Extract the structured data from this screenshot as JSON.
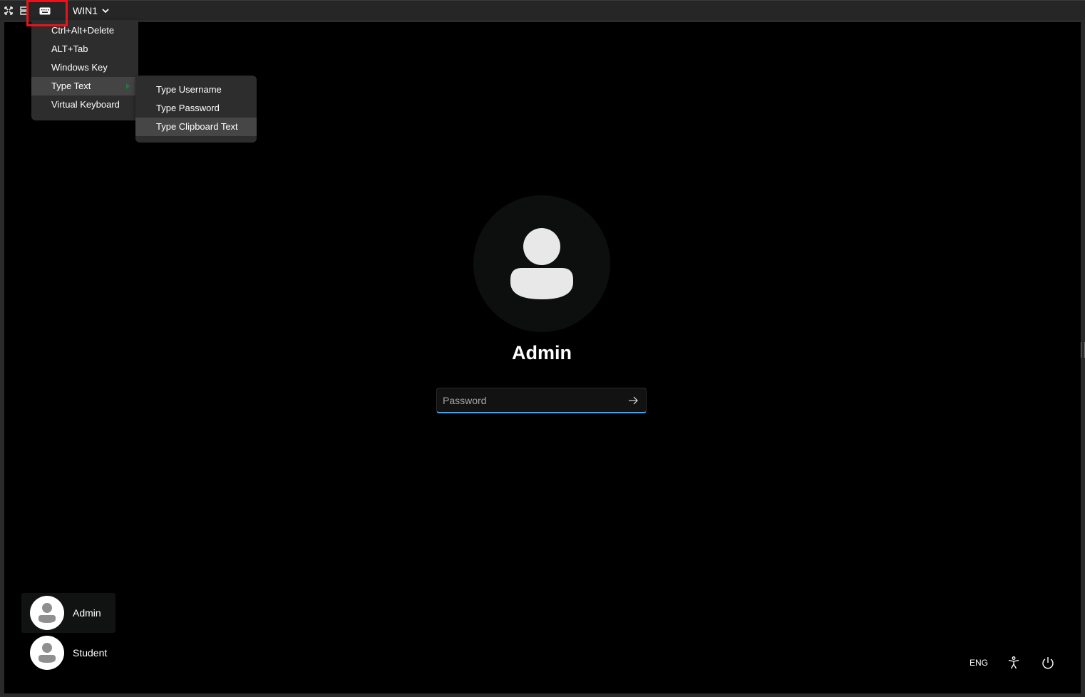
{
  "toolbar": {
    "machine_name": "WIN1",
    "icons": [
      "fullscreen-icon",
      "grid-icon",
      "keyboard-icon",
      "chevron-down-icon"
    ]
  },
  "keyboard_menu": {
    "items": [
      {
        "label": "Ctrl+Alt+Delete"
      },
      {
        "label": "ALT+Tab"
      },
      {
        "label": "Windows Key"
      },
      {
        "label": "Type Text",
        "has_submenu": true,
        "active": true
      },
      {
        "label": "Virtual Keyboard"
      }
    ],
    "submenu": {
      "items": [
        {
          "label": "Type Username"
        },
        {
          "label": "Type Password"
        },
        {
          "label": "Type Clipboard Text",
          "active": true
        }
      ]
    }
  },
  "login": {
    "user_name": "Admin",
    "password_placeholder": "Password",
    "password_value": ""
  },
  "user_list": [
    {
      "name": "Admin",
      "selected": true
    },
    {
      "name": "Student",
      "selected": false
    }
  ],
  "system_tray": {
    "language": "ENG",
    "icons": [
      "accessibility-icon",
      "power-icon"
    ]
  },
  "colors": {
    "highlight_box": "#e8141c",
    "focus_underline": "#4ea1e6",
    "screen_background": "#000000",
    "menu_background": "#2d2d2d"
  }
}
